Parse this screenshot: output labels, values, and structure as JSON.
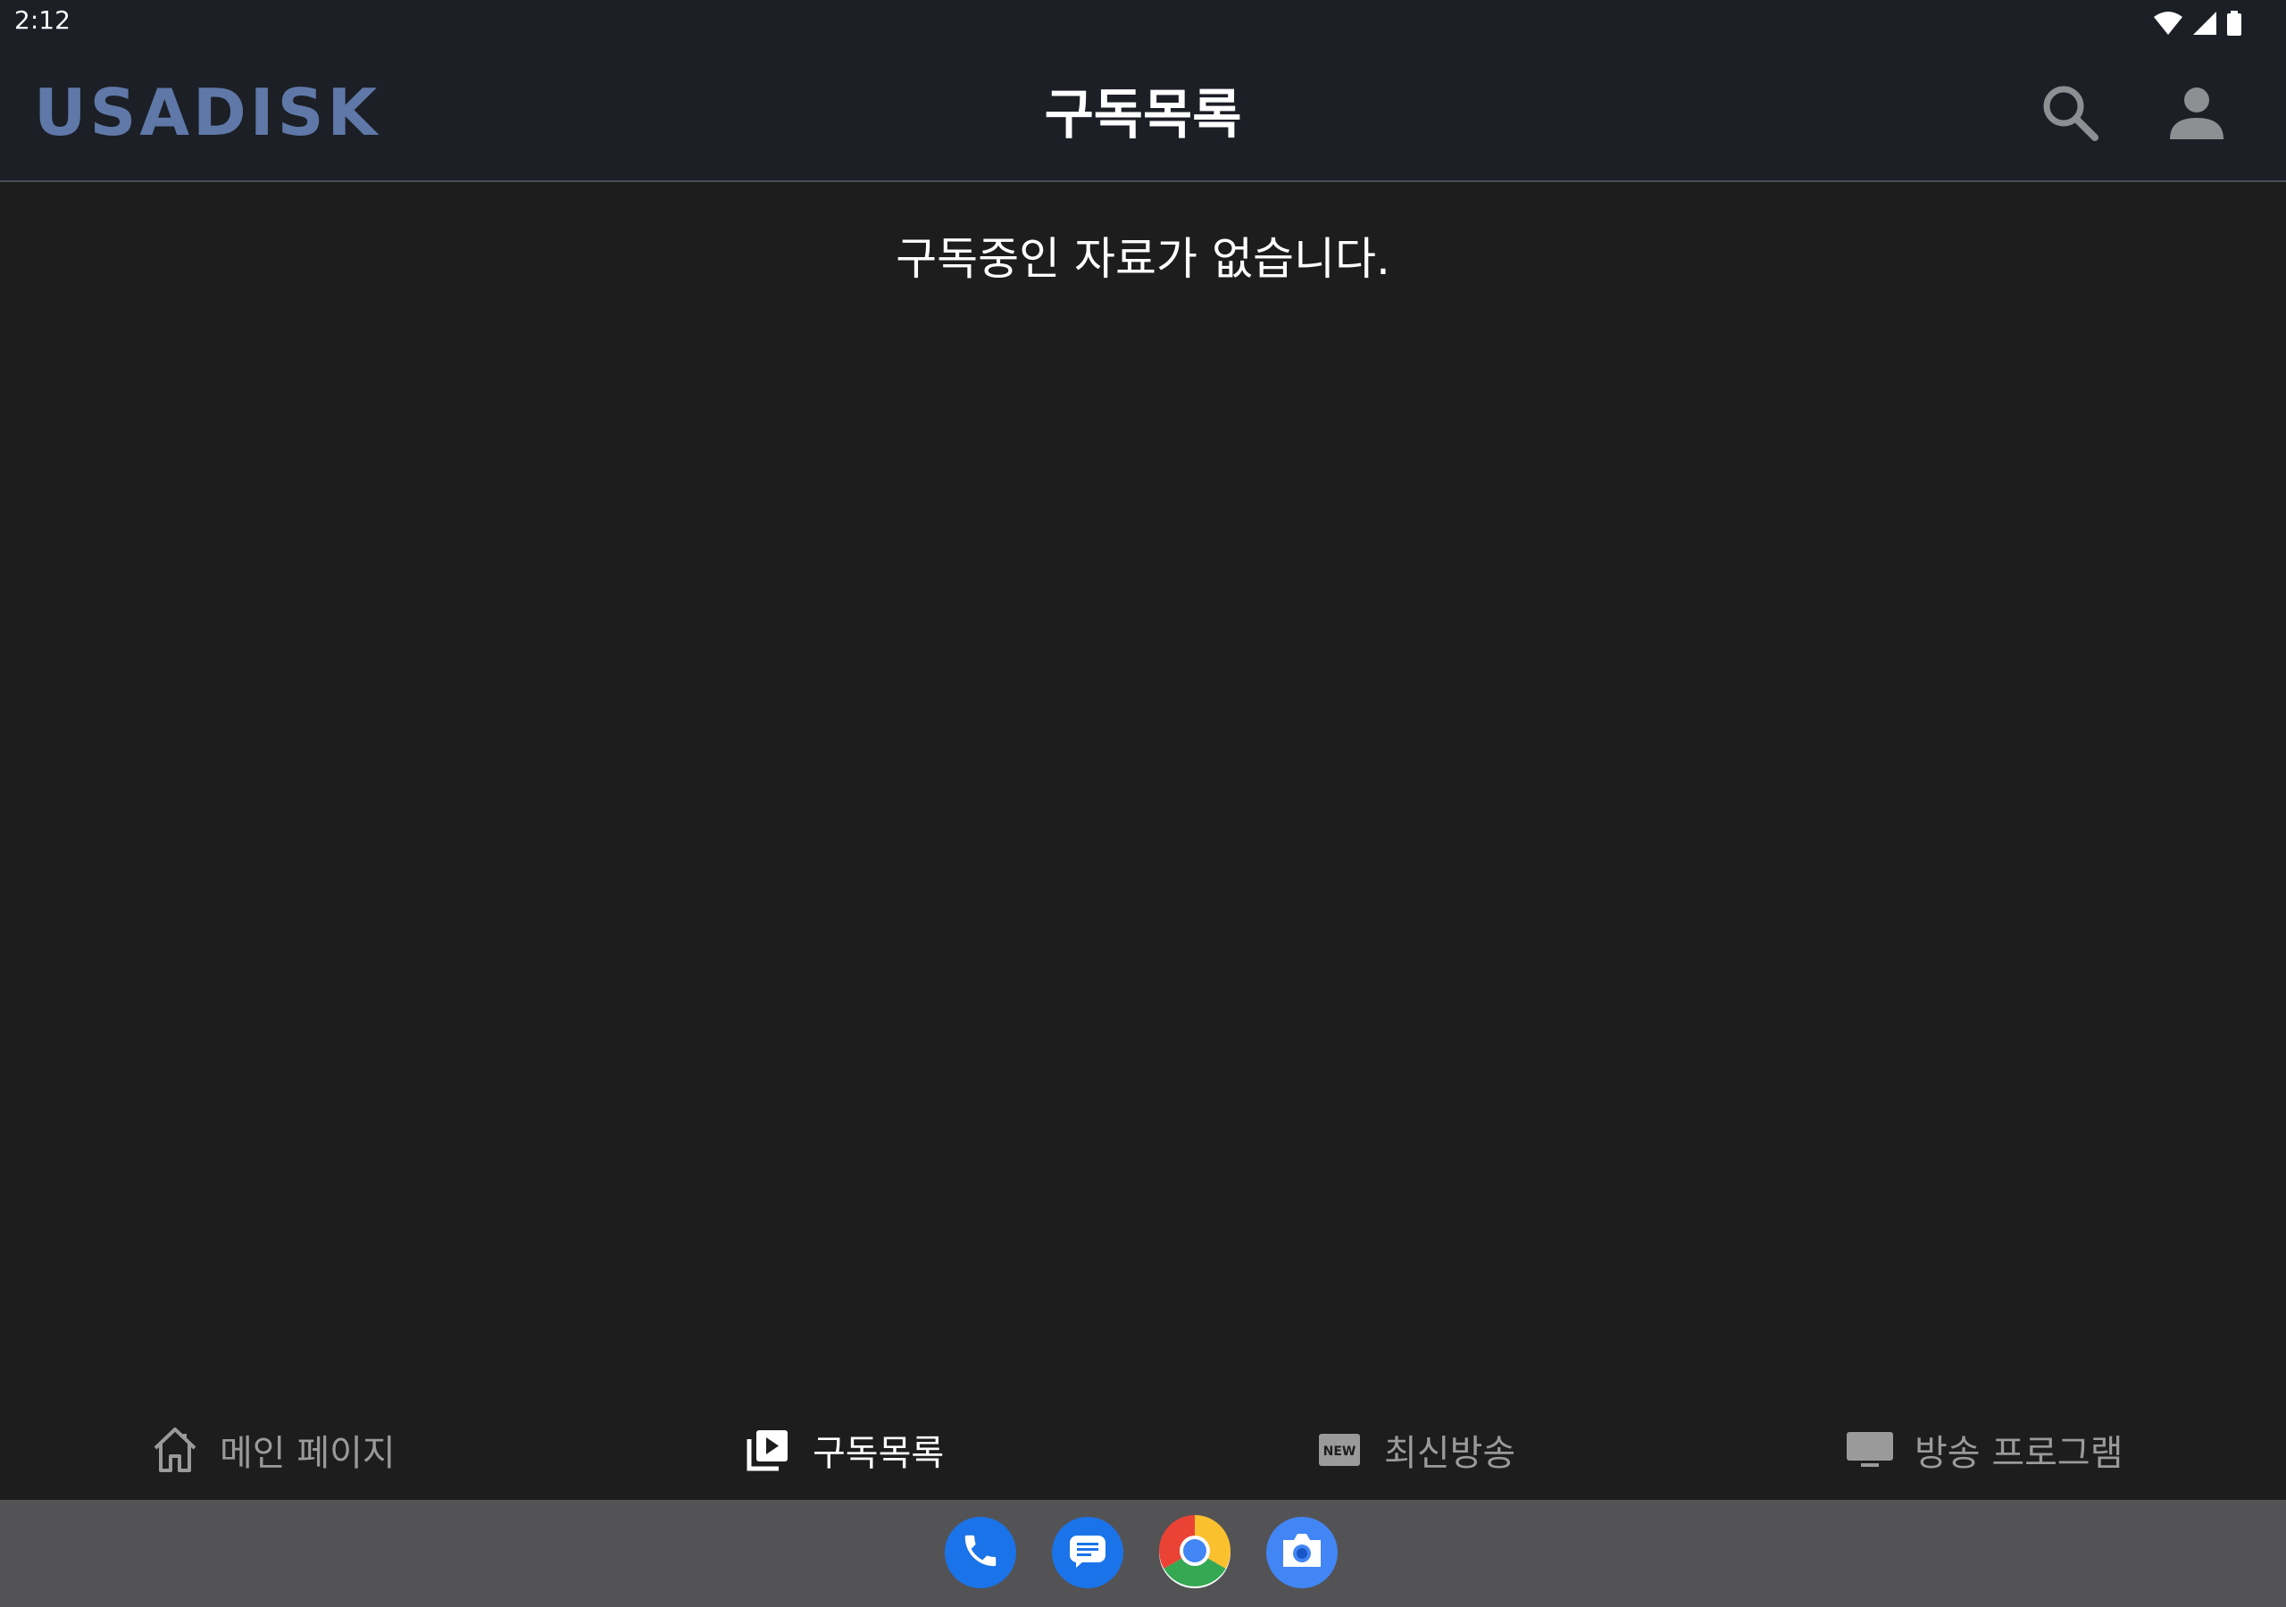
{
  "status_bar": {
    "time": "2:12"
  },
  "header": {
    "logo": "USADISK",
    "title": "구독목록",
    "search_icon": "search-icon",
    "account_icon": "account-icon"
  },
  "main": {
    "empty_message": "구독중인 자료가 없습니다."
  },
  "bottom_nav": {
    "items": [
      {
        "label": "메인 페이지",
        "icon": "home-icon",
        "active": false
      },
      {
        "label": "구독목록",
        "icon": "subscriptions-icon",
        "active": true
      },
      {
        "label": "최신방송",
        "icon": "new-badge-icon",
        "active": false
      },
      {
        "label": "방송 프로그램",
        "icon": "tv-icon",
        "active": false
      }
    ]
  },
  "dock": {
    "apps": [
      "phone-icon",
      "messages-icon",
      "chrome-icon",
      "camera-icon"
    ]
  },
  "colors": {
    "header_bg": "#1c1f26",
    "content_bg": "#1d1d1e",
    "logo": "#5f78a8",
    "inactive_nav": "#9a9a9a",
    "active_nav": "#ffffff",
    "dock_bg": "#535356"
  }
}
